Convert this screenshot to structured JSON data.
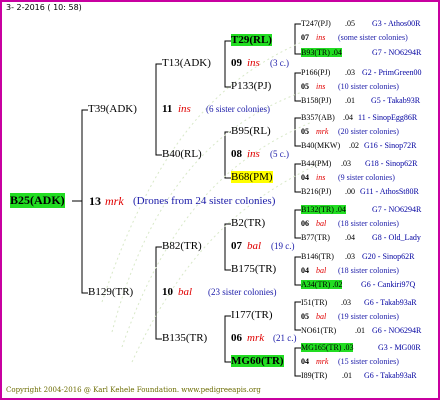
{
  "date": "3- 2-2016 ( 10: 58)",
  "root": {
    "name": "B25(ADK)",
    "num": "13",
    "grade": "mrk",
    "note": "(Drones from 24 sister colonies)"
  },
  "gen2": [
    {
      "name": "T39(ADK)",
      "num": "11",
      "grade": "ins",
      "note": "(6 sister colonies)"
    },
    {
      "name": "B129(TR)",
      "num": "10",
      "grade": "bal",
      "note": "(23 sister colonies)"
    }
  ],
  "gen3": [
    {
      "name": "T13(ADK)",
      "num": "09",
      "grade": "ins",
      "note": "(3 c.)"
    },
    {
      "name": "P133(PJ)"
    },
    {
      "name": "B95(RL)"
    },
    {
      "name": "B40(RL)",
      "num": "08",
      "grade": "ins",
      "note": "(5 c.)"
    },
    {
      "name": "B68(PM)"
    },
    {
      "name": "B2(TR)"
    },
    {
      "name": "B82(TR)",
      "num": "07",
      "grade": "bal",
      "note": "(19 c.)"
    },
    {
      "name": "B175(TR)"
    },
    {
      "name": "I177(TR)"
    },
    {
      "name": "B135(TR)",
      "num": "06",
      "grade": "mrk",
      "note": "(21 c.)"
    },
    {
      "name": "MG60(TR)"
    },
    {
      "name": "T29(RL)"
    }
  ],
  "gen4": [
    {
      "name": "T247(PJ)",
      "num": ".05",
      "src": "G3 - Athos00R"
    },
    {
      "name": "07",
      "grade": "ins",
      "note": "(some sister colonies)"
    },
    {
      "name": "B93(TR) .04",
      "src": "G7 - NO6294R"
    },
    {
      "name": "P166(PJ)",
      "num": ".03",
      "src": "G2 - PrimGreen00"
    },
    {
      "name": "05",
      "grade": "ins",
      "note": "(10 sister colonies)"
    },
    {
      "name": "B158(PJ)",
      "num": ".01",
      "src": "G5 - Takab93R"
    },
    {
      "name": "B357(AB)",
      "num": ".04",
      "src": "11 - SinopEgg86R"
    },
    {
      "name": "05",
      "grade": "mrk",
      "note": "(20 sister colonies)"
    },
    {
      "name": "B40(MKW)",
      "num": ".02",
      "src": "G16 - Sinop72R"
    },
    {
      "name": "B44(PM)",
      "num": ".03",
      "src": "G18 - Sinop62R"
    },
    {
      "name": "04",
      "grade": "ins",
      "note": "(9 sister colonies)"
    },
    {
      "name": "B216(PJ)",
      "num": ".00",
      "src": "G11 - AthosSt80R"
    },
    {
      "name": "B132(TR) .04",
      "src": "G7 - NO6294R"
    },
    {
      "name": "06",
      "grade": "bal",
      "note": "(18 sister colonies)"
    },
    {
      "name": "B77(TR)",
      "num": ".04",
      "src": "G8 - Old_Lady"
    },
    {
      "name": "B146(TR)",
      "num": ".03",
      "src": "G20 - Sinop62R"
    },
    {
      "name": "04",
      "grade": "bal",
      "note": "(18 sister colonies)"
    },
    {
      "name": "A34(TR) .02",
      "src": "G6 - Cankiri97Q"
    },
    {
      "name": "I51(TR)",
      "num": ".03",
      "src": "G6 - Takab93aR"
    },
    {
      "name": "05",
      "grade": "bal",
      "note": "(19 sister colonies)"
    },
    {
      "name": "NO61(TR)",
      "num": ".01",
      "src": "G6 - NO6294R"
    },
    {
      "name": "MG165(TR) .03",
      "src": "G3 - MG00R"
    },
    {
      "name": "04",
      "grade": "mrk",
      "note": "(15 sister colonies)"
    },
    {
      "name": "I89(TR)",
      "num": ".01",
      "src": "G6 - Takab93aR"
    }
  ],
  "footer": "Copyright 2004-2016 @ Karl Kehele Foundation.   www.pedigreeapis.org"
}
